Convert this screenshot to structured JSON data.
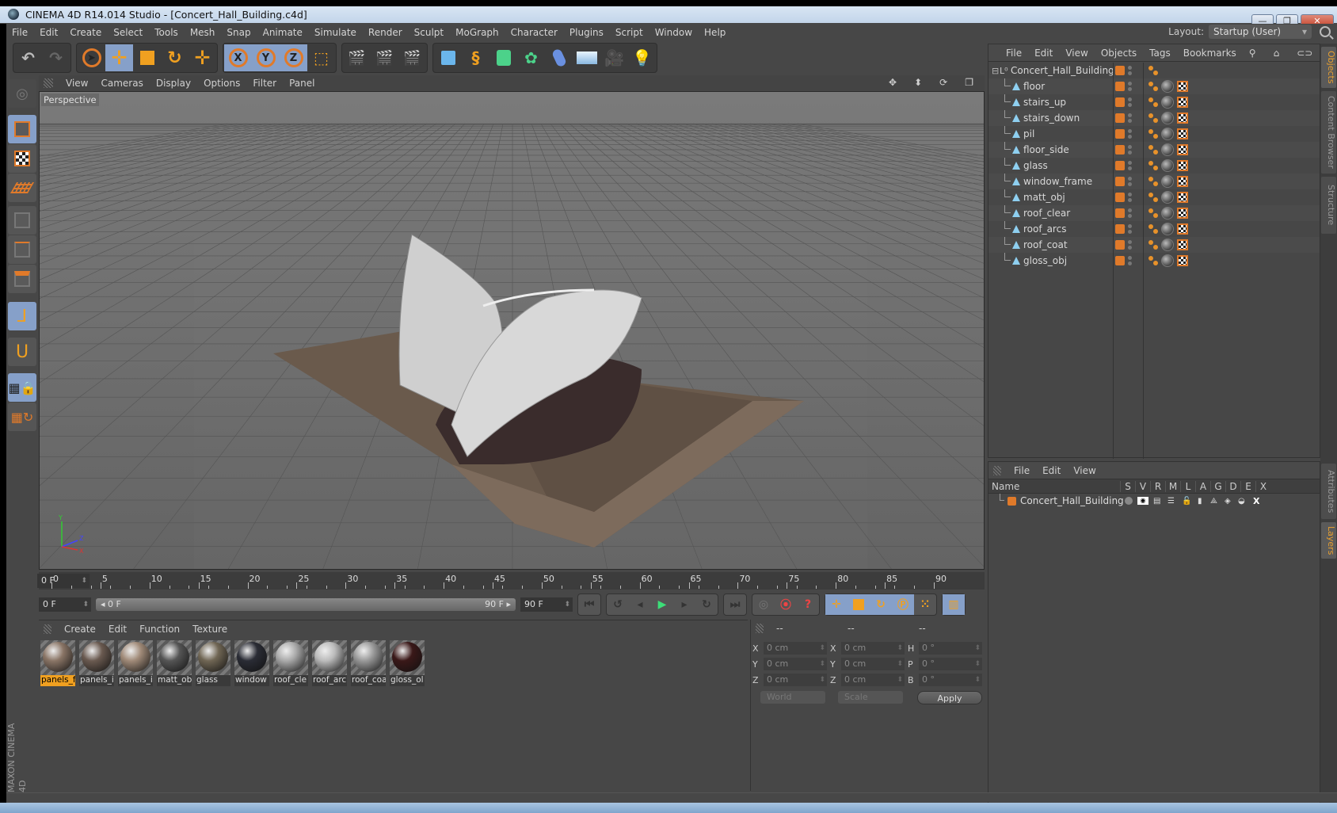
{
  "window": {
    "title": "CINEMA 4D R14.014 Studio - [Concert_Hall_Building.c4d]",
    "minimize": "—",
    "restore": "❐",
    "close": "✕"
  },
  "menu": [
    "File",
    "Edit",
    "Create",
    "Select",
    "Tools",
    "Mesh",
    "Snap",
    "Animate",
    "Simulate",
    "Render",
    "Sculpt",
    "MoGraph",
    "Character",
    "Plugins",
    "Script",
    "Window",
    "Help"
  ],
  "layout": {
    "label": "Layout:",
    "value": "Startup (User)"
  },
  "toolbar": {
    "groups": [
      [
        "undo",
        "redo"
      ],
      [
        "live-selection",
        "move",
        "scale",
        "rotate",
        "last-tool"
      ],
      [
        "x-axis",
        "y-axis",
        "z-axis",
        "coordinate-system"
      ],
      [
        "render-view",
        "render-picture-viewer",
        "render-settings"
      ],
      [
        "cube",
        "spline-pen",
        "subdivision",
        "array",
        "deformer",
        "floor",
        "camera",
        "light"
      ]
    ],
    "axis_labels": {
      "x": "X",
      "y": "Y",
      "z": "Z"
    }
  },
  "left_tools": [
    "make-editable",
    "model-mode",
    "texture-mode",
    "workplane-mode",
    "points-mode",
    "edges-mode",
    "polygons-mode",
    "enable-axis",
    "tweak-magnet",
    "locked-workplane",
    "workplane-rotate"
  ],
  "viewport": {
    "menu": [
      "View",
      "Cameras",
      "Display",
      "Options",
      "Filter",
      "Panel"
    ],
    "camera_label": "Perspective",
    "axis": {
      "x": "X",
      "y": "Y",
      "z": "Z"
    }
  },
  "objects_panel": {
    "menu": [
      "File",
      "Edit",
      "View",
      "Objects",
      "Tags",
      "Bookmarks"
    ],
    "root": {
      "name": "Concert_Hall_Building",
      "badge": "0"
    },
    "children": [
      "floor",
      "stairs_up",
      "stairs_down",
      "pil",
      "floor_side",
      "glass",
      "window_frame",
      "matt_obj",
      "roof_clear",
      "roof_arcs",
      "roof_coat",
      "gloss_obj"
    ]
  },
  "layers_panel": {
    "menu": [
      "File",
      "Edit",
      "View"
    ],
    "columns": [
      "Name",
      "S",
      "V",
      "R",
      "M",
      "L",
      "A",
      "G",
      "D",
      "E",
      "X"
    ],
    "rows": [
      {
        "name": "Concert_Hall_Building",
        "color": "#e07a2a"
      }
    ]
  },
  "side_tabs_top": [
    {
      "label": "Objects",
      "active": true
    },
    {
      "label": "Content Browser",
      "active": false
    },
    {
      "label": "Structure",
      "active": false
    }
  ],
  "side_tabs_bottom": [
    {
      "label": "Attributes",
      "active": false
    },
    {
      "label": "Layers",
      "active": true
    }
  ],
  "timeline": {
    "ticks": [
      0,
      5,
      10,
      15,
      20,
      25,
      30,
      35,
      40,
      45,
      50,
      55,
      60,
      65,
      70,
      75,
      80,
      85,
      90
    ],
    "current_frame": "0 F",
    "min_frame": 0,
    "max_frame": 90
  },
  "anim_controls": {
    "start_field": "0 F",
    "range_start": "◂ 0 F",
    "range_end": "90 F ▸",
    "end_field": "90 F",
    "buttons": [
      "go-to-start",
      "previous-key",
      "previous-frame",
      "play",
      "next-frame",
      "next-key",
      "go-to-end",
      "record-auto",
      "autokey",
      "keyframe-selection",
      "pos",
      "scale",
      "rot",
      "param",
      "pla",
      "timeline"
    ]
  },
  "materials": {
    "menu": [
      "Create",
      "Edit",
      "Function",
      "Texture"
    ],
    "items": [
      {
        "label": "panels_f",
        "selected": true,
        "color": "#8a7566"
      },
      {
        "label": "panels_i",
        "selected": false,
        "color": "#6a5a50"
      },
      {
        "label": "panels_i",
        "selected": false,
        "color": "#a08a78"
      },
      {
        "label": "matt_ob",
        "selected": false,
        "color": "#555"
      },
      {
        "label": "glass",
        "selected": false,
        "color": "#706654"
      },
      {
        "label": "window",
        "selected": false,
        "color": "#2a2c35"
      },
      {
        "label": "roof_cle",
        "selected": false,
        "color": "#aaa"
      },
      {
        "label": "roof_arc",
        "selected": false,
        "color": "#bbb"
      },
      {
        "label": "roof_coa",
        "selected": false,
        "color": "#999"
      },
      {
        "label": "gloss_ol",
        "selected": false,
        "color": "#3a1818"
      }
    ]
  },
  "coordinates": {
    "headers": [
      "--",
      "--",
      "--"
    ],
    "rows": [
      {
        "l1": "X",
        "v1": "0 cm",
        "l2": "X",
        "v2": "0 cm",
        "l3": "H",
        "v3": "0 °"
      },
      {
        "l1": "Y",
        "v1": "0 cm",
        "l2": "Y",
        "v2": "0 cm",
        "l3": "P",
        "v3": "0 °"
      },
      {
        "l1": "Z",
        "v1": "0 cm",
        "l2": "Z",
        "v2": "0 cm",
        "l3": "B",
        "v3": "0 °"
      }
    ],
    "mode": "World",
    "transform": "Scale",
    "apply": "Apply"
  },
  "branding": "MAXON CINEMA 4D"
}
